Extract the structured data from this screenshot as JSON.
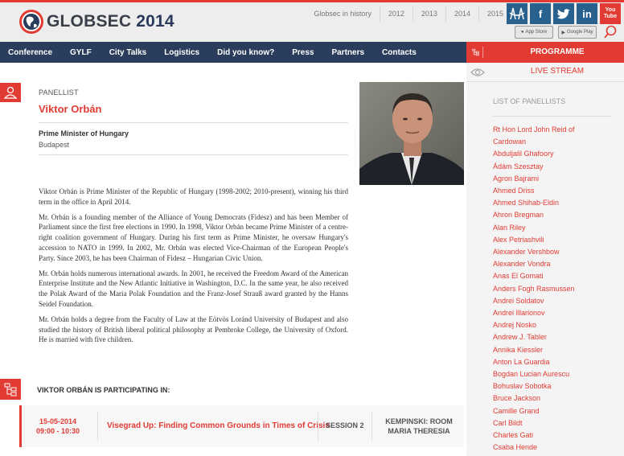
{
  "header": {
    "logo_main": "GLOBSEC",
    "logo_year": "2014",
    "years": [
      "Globsec in history",
      "2012",
      "2013",
      "2014",
      "2015"
    ],
    "social": [
      {
        "icon": "bridge-icon",
        "glyph": ""
      },
      {
        "icon": "facebook-icon",
        "glyph": "f"
      },
      {
        "icon": "twitter-icon",
        "glyph": ""
      },
      {
        "icon": "linkedin-icon",
        "glyph": "in"
      },
      {
        "icon": "youtube-icon",
        "glyph": "You Tube"
      }
    ],
    "stores": [
      "App Store",
      "Google Play"
    ]
  },
  "nav": {
    "items": [
      "Conference",
      "GYLF",
      "City Talks",
      "Logistics",
      "Did you know?",
      "Press",
      "Partners",
      "Contacts"
    ]
  },
  "programme_label": "PROGRAMME",
  "livestream_label": "LIVE STREAM",
  "panellist": {
    "section_label": "PANELLIST",
    "name": "Viktor Orbán",
    "role": "Prime Minister of Hungary",
    "city": "Budapest",
    "bio": [
      "Viktor Orbán is Prime Minister of the Republic of Hungary (1998-2002; 2010-present), winning his third term in the office in April 2014.",
      "Mr. Orbán is a founding member of the Alliance of Young Democrats (Fidesz) and has been Member of Parliament since the first free elections in 1990. In 1998, Viktor Orbán became Prime Minister of a centre-right coalition government of Hungary. During his first term as Prime Minister, he oversaw Hungary's accession to NATO in 1999. In 2002, Mr. Orbán was elected Vice-Chairman of the European People's Party. Since 2003, he has been Chairman of Fidesz – Hungarian Civic Union.",
      "Mr. Orbán holds numerous international awards. In 2001, he received the Freedom Award of the American Enterprise Institute and the New Atlantic Initiative in Washington, D.C. In the same year, he also received the Polak Award of the Maria Polak Foundation and the Franz-Josef Strauß award granted by the Hanns Seidel Foundation.",
      "Mr. Orbán holds a degree from the Faculty of Law at the Eötvös Loránd University of Budapest and also studied the history of British liberal political philosophy at Pembroke College, the University of Oxford. He is married with five children."
    ]
  },
  "participating": {
    "title": "VIKTOR ORBÁN IS PARTICIPATING IN:",
    "date": "15-05-2014",
    "time": "09:00 - 10:30",
    "session_title": "Visegrad Up: Finding Common Grounds in Times of Crisis",
    "session": "SESSION 2",
    "venue_line1": "KEMPINSKI: ROOM",
    "venue_line2": "MARIA THERESIA"
  },
  "sidebar": {
    "title": "LIST OF PANELLISTS",
    "panellists": [
      "Rt Hon Lord John Reid of",
      "Cardowan",
      "Abduljalil Ghafoory",
      "Ádám Szesztay",
      "Agron Bajrami",
      "Ahmed Driss",
      "Ahmed Shihab-Eldin",
      "Ahron Bregman",
      "Alan Riley",
      "Alex Petriashvili",
      "Alexander Vershbow",
      "Alexander Vondra",
      "Anas El Gomati",
      "Anders Fogh Rasmussen",
      "Andrei Soldatov",
      "Andrei Illarionov",
      "Andrej Nosko",
      "Andrew J. Tabler",
      "Annika Kiessler",
      "Anton La Guardia",
      "Bogdan Lucian Aurescu",
      "Bohuslav Sobotka",
      "Bruce Jackson",
      "Camille Grand",
      "Carl Bildt",
      "Charles Gati",
      "Csaba Hende"
    ]
  },
  "colors": {
    "accent": "#e23b33",
    "nav_bg": "#2a3d5c",
    "header_bg": "#ededed",
    "sidebar_bg": "#f4f4f4"
  }
}
